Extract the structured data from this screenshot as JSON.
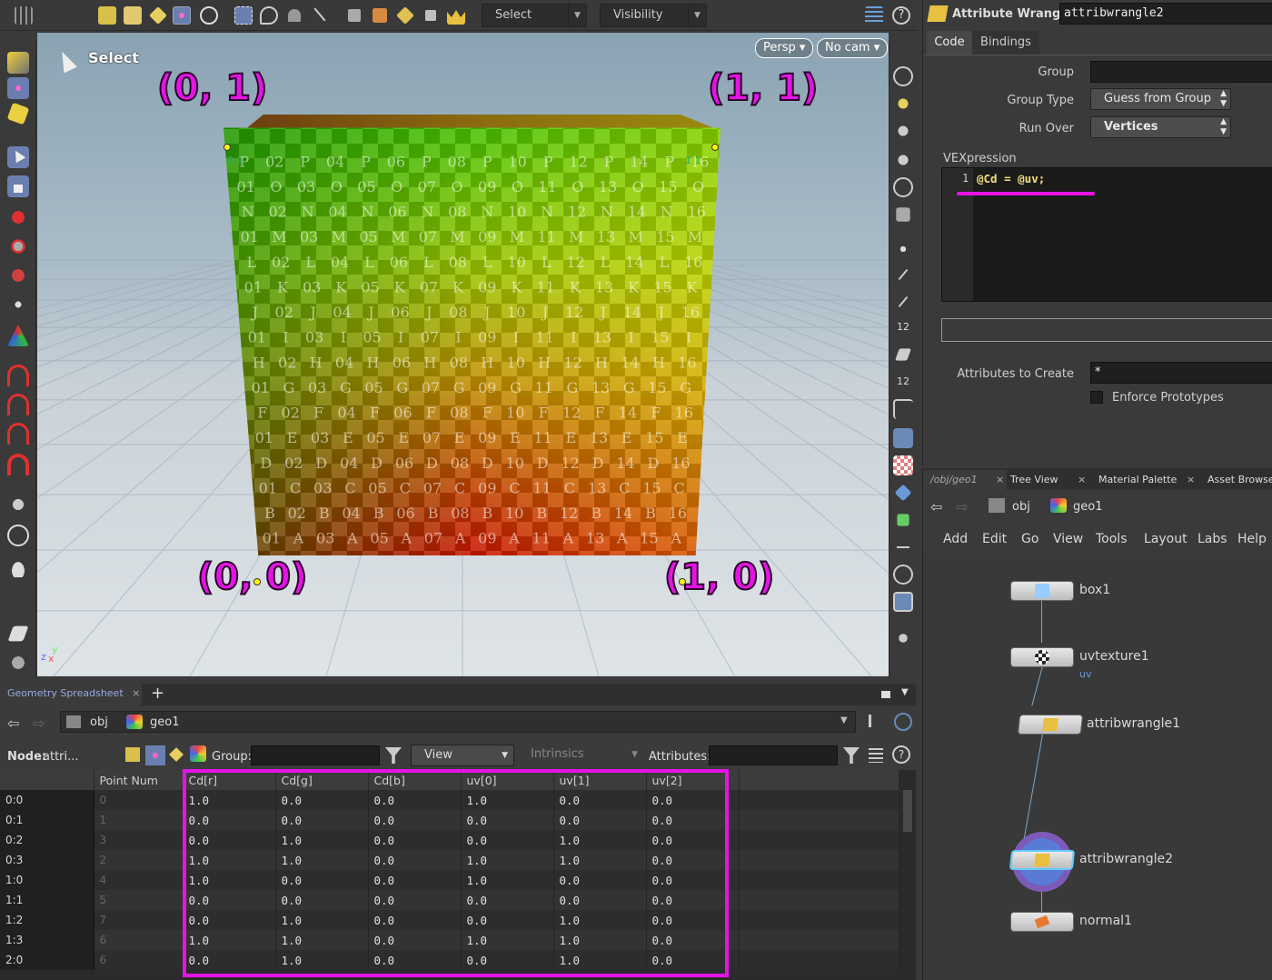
{
  "top_bar": {
    "select_dropdown": "Select",
    "visibility_dropdown": "Visibility",
    "help_glyph": "?"
  },
  "viewport": {
    "mode_label": "Select",
    "persp_button": "Persp ▾",
    "cam_button": "No cam ▾",
    "annotations": {
      "top_left": "(0, 1)",
      "top_right": "(1, 1)",
      "bottom_left": "(0, 0)",
      "bottom_right": "(1, 0)"
    },
    "axis_z": "z",
    "axis_x": "x",
    "axis_y": "y",
    "cube_letters": [
      "P",
      "O",
      "N",
      "M",
      "L",
      "K",
      "J",
      "I",
      "H",
      "G",
      "F",
      "E",
      "D",
      "C",
      "B",
      "A"
    ],
    "corner_small_labels": {
      "tl": "0 1",
      "tr": "1 1",
      "bl": "0 0",
      "br": "1 0"
    },
    "colors": {
      "annotation": "#e414e4",
      "cube_top_left": "#2ea800",
      "cube_top_right": "#d8d800",
      "cube_bottom_left": "#8a1400",
      "cube_bottom_right": "#c81400"
    }
  },
  "spreadsheet": {
    "tab_label": "Geometry Spreadsheet",
    "tab_close": "×",
    "add_tab": "+",
    "path": [
      "obj",
      "geo1"
    ],
    "node_label": "Node:",
    "node_value": "attri...",
    "group_label": "Group:",
    "view_dropdown": "View",
    "intrinsics_dropdown": "Intrinsics",
    "attributes_label": "Attributes:",
    "columns": [
      "",
      "Point Num",
      "Cd[r]",
      "Cd[g]",
      "Cd[b]",
      "uv[0]",
      "uv[1]",
      "uv[2]"
    ],
    "rows": [
      [
        "0:0",
        "0",
        "1.0",
        "0.0",
        "0.0",
        "1.0",
        "0.0",
        "0.0"
      ],
      [
        "0:1",
        "1",
        "0.0",
        "0.0",
        "0.0",
        "0.0",
        "0.0",
        "0.0"
      ],
      [
        "0:2",
        "3",
        "0.0",
        "1.0",
        "0.0",
        "0.0",
        "1.0",
        "0.0"
      ],
      [
        "0:3",
        "2",
        "1.0",
        "1.0",
        "0.0",
        "1.0",
        "1.0",
        "0.0"
      ],
      [
        "1:0",
        "4",
        "1.0",
        "0.0",
        "0.0",
        "1.0",
        "0.0",
        "0.0"
      ],
      [
        "1:1",
        "5",
        "0.0",
        "0.0",
        "0.0",
        "0.0",
        "0.0",
        "0.0"
      ],
      [
        "1:2",
        "7",
        "0.0",
        "1.0",
        "0.0",
        "0.0",
        "1.0",
        "0.0"
      ],
      [
        "1:3",
        "6",
        "1.0",
        "1.0",
        "0.0",
        "1.0",
        "1.0",
        "0.0"
      ],
      [
        "2:0",
        "6",
        "0.0",
        "1.0",
        "0.0",
        "0.0",
        "1.0",
        "0.0"
      ]
    ]
  },
  "params": {
    "node_type": "Attribute Wrangle",
    "node_name": "attribwrangle2",
    "tabs": [
      "Code",
      "Bindings"
    ],
    "group_label": "Group",
    "group_value": "",
    "group_type_label": "Group Type",
    "group_type_value": "Guess from Group",
    "run_over_label": "Run Over",
    "run_over_value": "Vertices",
    "vexpression_label": "VEXpression",
    "code_line_number": "1",
    "code": "@Cd = @uv;",
    "attributes_to_create_label": "Attributes to Create",
    "attributes_to_create_value": "*",
    "enforce_prototypes_label": "Enforce Prototypes"
  },
  "network": {
    "tabs": [
      "/obj/geo1",
      "Tree View",
      "Material Palette",
      "Asset Browse"
    ],
    "path": [
      "obj",
      "geo1"
    ],
    "menu": [
      "Add",
      "Edit",
      "Go",
      "View",
      "Tools",
      "Layout",
      "Labs",
      "Help"
    ],
    "nodes": [
      {
        "name": "box1",
        "sub": ""
      },
      {
        "name": "uvtexture1",
        "sub": "uv"
      },
      {
        "name": "attribwrangle1",
        "sub": ""
      },
      {
        "name": "attribwrangle2",
        "sub": ""
      },
      {
        "name": "normal1",
        "sub": ""
      }
    ]
  }
}
